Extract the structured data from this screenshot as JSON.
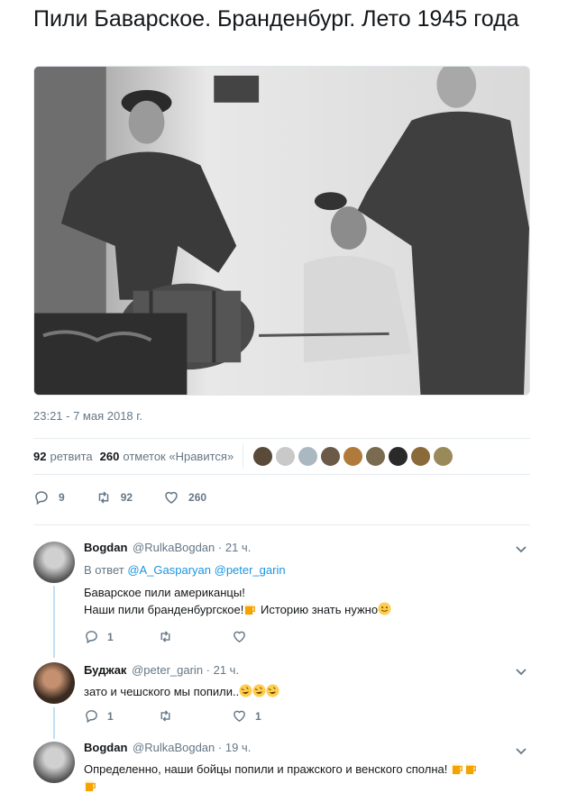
{
  "tweet": {
    "text": "Пили Баварское. Бранденбург. Лето 1945 года",
    "timestamp": "23:21 - 7 мая 2018 г.",
    "retweets_count": "92",
    "retweets_label": "ретвита",
    "likes_count": "260",
    "likes_label": "отметок «Нравится»",
    "actions": {
      "replies": "9",
      "retweets": "92",
      "likes": "260"
    }
  },
  "replies": [
    {
      "name": "Bogdan",
      "handle": "@RulkaBogdan",
      "time": "· 21 ч.",
      "reply_to_prefix": "В ответ",
      "reply_to_mentions": "@A_Gasparyan @peter_garin",
      "line1": "Баварское пили американцы!",
      "line2a": "Наши пили бранденбургское!",
      "line2b": " Историю знать нужно",
      "replies": "1",
      "retweets": "",
      "likes": ""
    },
    {
      "name": "Буджак",
      "handle": "@peter_garin",
      "time": "· 21 ч.",
      "line1": "зато и чешского мы попили..",
      "replies": "1",
      "retweets": "",
      "likes": "1"
    },
    {
      "name": "Bogdan",
      "handle": "@RulkaBogdan",
      "time": "· 19 ч.",
      "line1": "Определенно, наши бойцы попили и пражского и венского сполна!"
    }
  ],
  "colors": {
    "text": "#14171a",
    "muted": "#657786",
    "link": "#1b95e0",
    "thread": "#c4e0f3",
    "divider": "#e6ecf0"
  },
  "icons": [
    "reply-icon",
    "retweet-icon",
    "heart-icon",
    "chevron-down-icon",
    "beer-emoji",
    "smile-emoji",
    "rofl-emoji"
  ]
}
